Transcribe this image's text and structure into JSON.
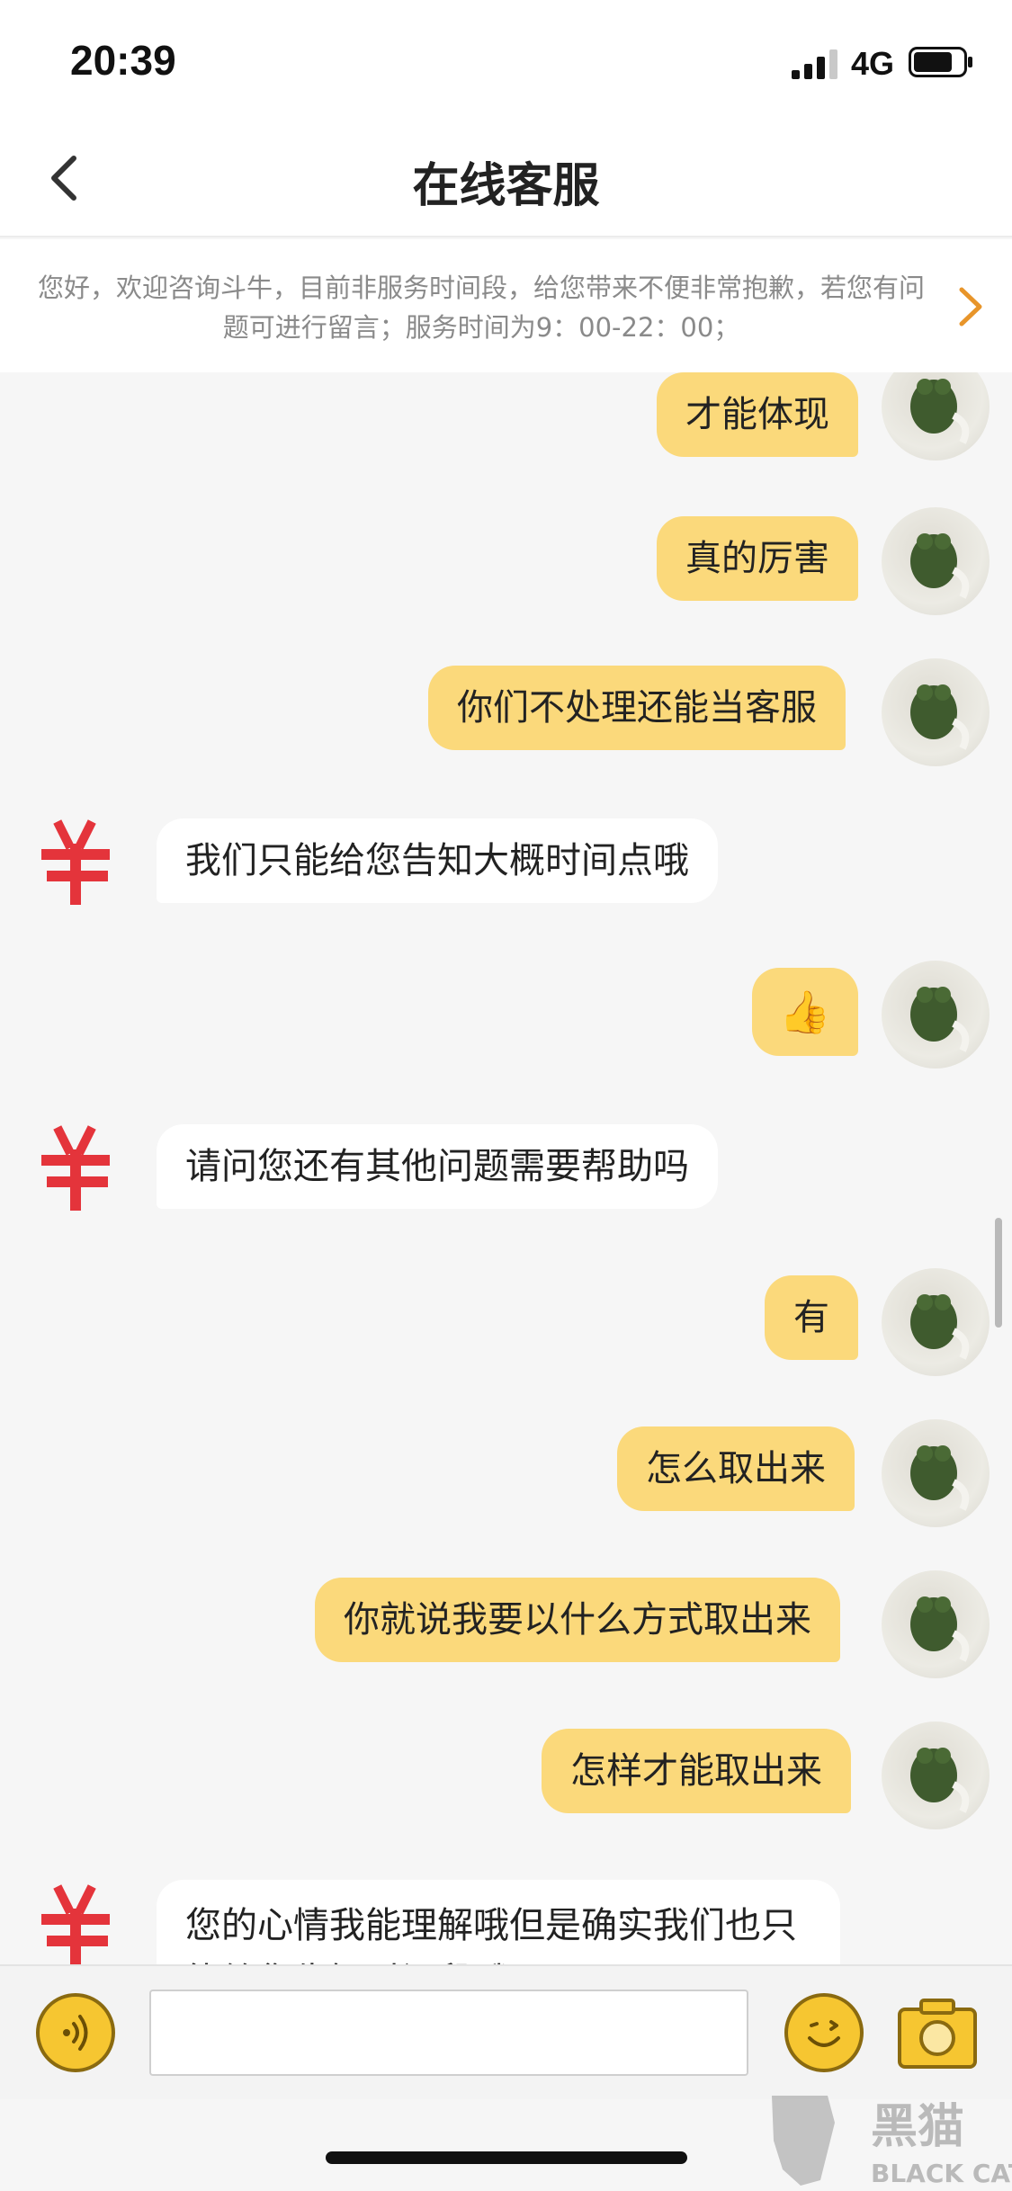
{
  "status_bar": {
    "time": "20:39",
    "network": "4G"
  },
  "nav": {
    "title": "在线客服"
  },
  "notice": {
    "text": "您好，欢迎咨询斗牛，目前非服务时间段，给您带来不便非常抱歉，若您有问题可进行留言；服务时间为9：00-22：00；"
  },
  "messages": [
    {
      "sender": "me",
      "text": "才能体现"
    },
    {
      "sender": "me",
      "text": "真的厉害"
    },
    {
      "sender": "me",
      "text": "你们不处理还能当客服"
    },
    {
      "sender": "agent",
      "text": "我们只能给您告知大概时间点哦"
    },
    {
      "sender": "me",
      "text": "👍"
    },
    {
      "sender": "agent",
      "text": "请问您还有其他问题需要帮助吗"
    },
    {
      "sender": "me",
      "text": "有"
    },
    {
      "sender": "me",
      "text": "怎么取出来"
    },
    {
      "sender": "me",
      "text": "你就说我要以什么方式取出来"
    },
    {
      "sender": "me",
      "text": "怎样才能取出来"
    },
    {
      "sender": "agent",
      "text": "您的心情我能理解哦但是确实我们也只能给您告知时间段哦"
    }
  ],
  "input": {
    "placeholder": ""
  },
  "watermark": {
    "brand": "黑猫",
    "sub": "BLACK CAT"
  },
  "colors": {
    "my_bubble": "#fbd97b",
    "agent_bubble": "#ffffff",
    "accent": "#f6c631",
    "arrow": "#e8952a",
    "agent_logo": "#e4343b"
  }
}
